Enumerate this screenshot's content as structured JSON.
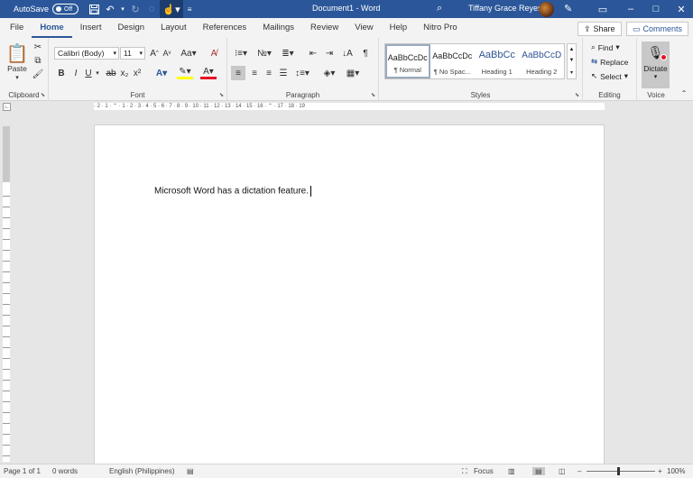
{
  "titlebar": {
    "autosave_label": "AutoSave",
    "autosave_state": "Off",
    "doc_title": "Document1 - Word",
    "user_name": "Tiffany Grace Reyes"
  },
  "tabs": [
    {
      "label": "File"
    },
    {
      "label": "Home"
    },
    {
      "label": "Insert"
    },
    {
      "label": "Design"
    },
    {
      "label": "Layout"
    },
    {
      "label": "References"
    },
    {
      "label": "Mailings"
    },
    {
      "label": "Review"
    },
    {
      "label": "View"
    },
    {
      "label": "Help"
    },
    {
      "label": "Nitro Pro"
    }
  ],
  "header_actions": {
    "share": "Share",
    "comments": "Comments"
  },
  "ribbon": {
    "clipboard": {
      "paste": "Paste",
      "label": "Clipboard"
    },
    "font": {
      "name": "Calibri (Body)",
      "size": "11",
      "label": "Font",
      "bold": "B",
      "italic": "I",
      "underline": "U",
      "case": "Aa"
    },
    "paragraph": {
      "label": "Paragraph"
    },
    "styles": {
      "label": "Styles",
      "items": [
        {
          "preview": "AaBbCcDc",
          "name": "¶ Normal"
        },
        {
          "preview": "AaBbCcDc",
          "name": "¶ No Spac..."
        },
        {
          "preview": "AaBbCc",
          "name": "Heading 1"
        },
        {
          "preview": "AaBbCcD",
          "name": "Heading 2"
        }
      ]
    },
    "editing": {
      "find": "Find",
      "replace": "Replace",
      "select": "Select",
      "label": "Editing"
    },
    "voice": {
      "dictate": "Dictate",
      "label": "Voice"
    }
  },
  "document": {
    "text": "Microsoft Word has a dictation feature."
  },
  "ruler_text": "· 2 · 1 · ⌃ · 1 · 2 · 3 · 4 · 5 · 6 · 7 · 8 · 9 · 10 · 11 · 12 · 13 · 14 · 15 · 16 · ⌃ · 17 · 18 · 19",
  "statusbar": {
    "page": "Page 1 of 1",
    "words": "0 words",
    "language": "English (Philippines)",
    "focus": "Focus",
    "zoom": "100%"
  },
  "colors": {
    "accent": "#2b579a",
    "highlight": "#ffff00",
    "font_color": "#e81123"
  }
}
